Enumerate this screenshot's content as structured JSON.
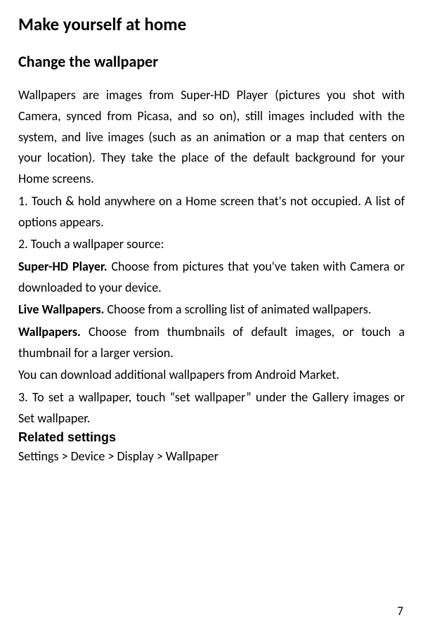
{
  "heading1": "Make yourself at home",
  "heading2": "Change the wallpaper",
  "para1": "Wallpapers are images from Super-HD Player (pictures you shot with Camera, synced from Picasa, and so on), still images included with the system, and live images (such as an animation or a map that centers on your location). They take the place of the default background for your Home screens.",
  "step1": "1. Touch & hold anywhere on a Home screen that's not occupied. A list of options appears.",
  "step2": "2. Touch a wallpaper source:",
  "source1_label": "Super-HD Player.",
  "source1_text": " Choose from pictures that you've taken with Camera or downloaded to your device.",
  "source2_label": "Live Wallpapers.",
  "source2_text": " Choose from a scrolling list of animated wallpapers.",
  "source3_label": "Wallpapers.",
  "source3_text": " Choose from thumbnails of default images, or touch a thumbnail for a larger version.",
  "download_note": "You can download additional wallpapers from Android Market.",
  "step3": "3. To set a wallpaper, touch “set wallpaper” under the Gallery images or Set wallpaper.",
  "related_heading": "Related settings",
  "settings_path": "Settings > Device > Display > Wallpaper",
  "page_number": "7"
}
